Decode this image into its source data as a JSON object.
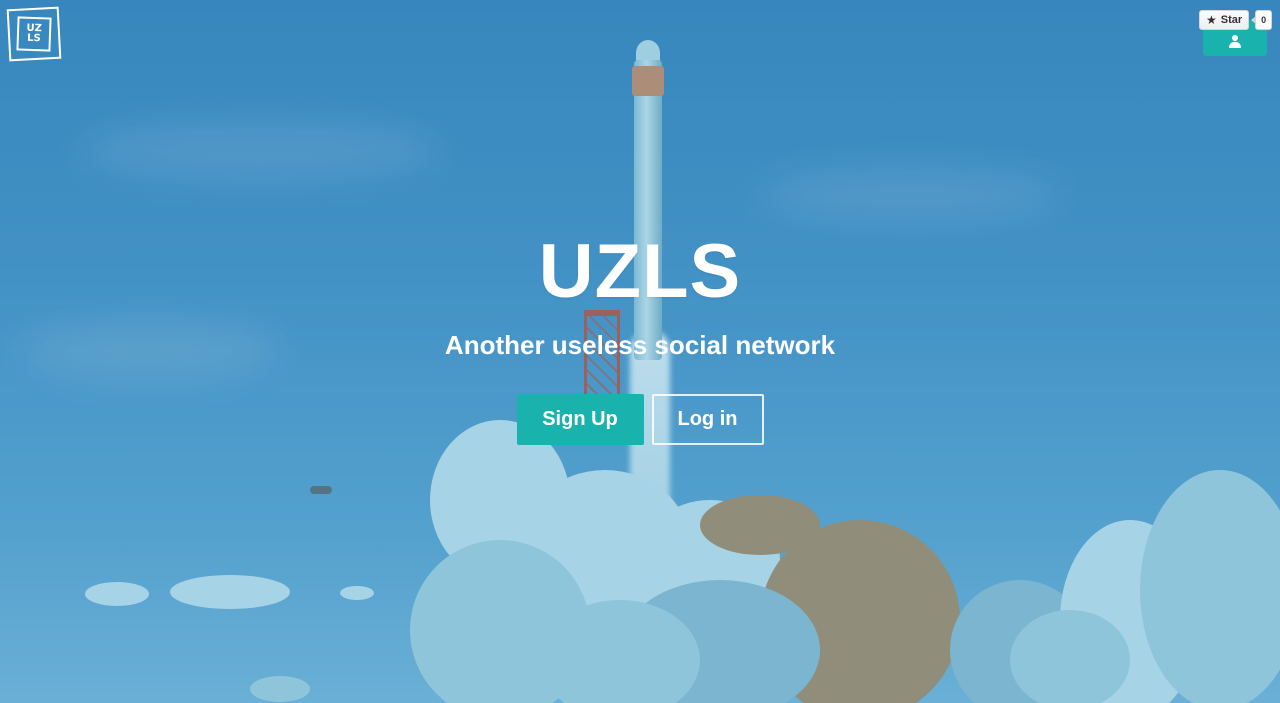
{
  "logo": {
    "text": "UZ\nLS"
  },
  "github": {
    "star_label": "Star",
    "star_count": "0",
    "icon": "star-icon"
  },
  "user_button": {
    "icon": "user-icon"
  },
  "hero": {
    "title": "UZLS",
    "tagline": "Another useless social network"
  },
  "actions": {
    "signup_label": "Sign Up",
    "login_label": "Log in"
  },
  "colors": {
    "accent": "#1ab2ac",
    "sky": "#4a94c8",
    "text": "#ffffff"
  }
}
